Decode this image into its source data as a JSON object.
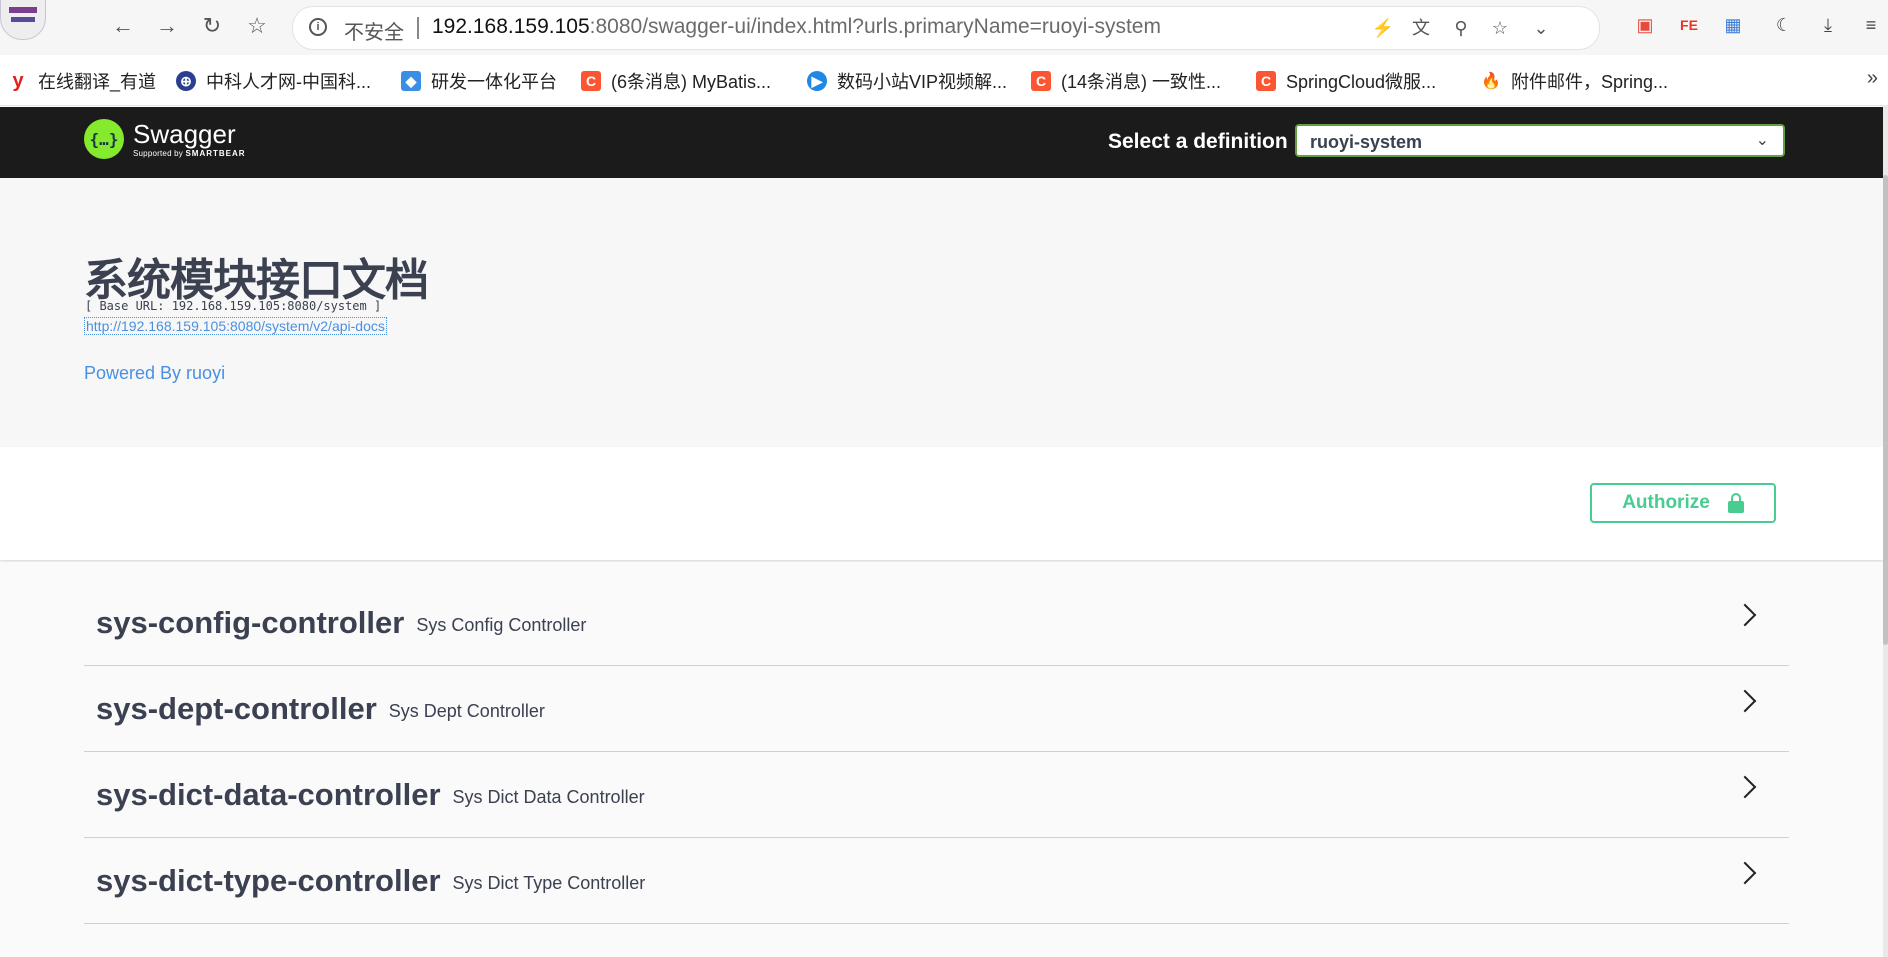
{
  "browser": {
    "url_security": "不安全",
    "url_host": "192.168.159.105",
    "url_rest": ":8080/swagger-ui/index.html?urls.primaryName=ruoyi-system"
  },
  "bookmarks": [
    {
      "label": "在线翻译_有道",
      "icon": "youdao-icon",
      "icon_text": "y",
      "color": "#e0201b"
    },
    {
      "label": "中科人才网-中国科...",
      "icon": "cas-icon",
      "icon_text": "⊕",
      "color": "#2a3f8f"
    },
    {
      "label": "研发一体化平台",
      "icon": "platform-icon",
      "icon_text": "◆",
      "color": "#3a8ee6"
    },
    {
      "label": "(6条消息) MyBatis...",
      "icon": "csdn-icon",
      "icon_text": "C",
      "color": "#fc5531"
    },
    {
      "label": "数码小站VIP视频解...",
      "icon": "video-icon",
      "icon_text": "▶",
      "color": "#1e88e5"
    },
    {
      "label": "(14条消息) 一致性...",
      "icon": "csdn-icon",
      "icon_text": "C",
      "color": "#fc5531"
    },
    {
      "label": "SpringCloud微服...",
      "icon": "csdn-icon",
      "icon_text": "C",
      "color": "#fc5531"
    },
    {
      "label": "附件邮件，Spring...",
      "icon": "flame-icon",
      "icon_text": "🔥",
      "color": "#ffffff"
    }
  ],
  "swagger": {
    "logo_name": "Swagger",
    "logo_sub_prefix": "Supported by",
    "logo_sub_brand": "SMARTBEAR",
    "definition_label": "Select a definition",
    "definition_value": "ruoyi-system"
  },
  "info": {
    "title": "系统模块接口文档",
    "base_url": "[ Base URL: 192.168.159.105:8080/system ]",
    "api_docs_link": "http://192.168.159.105:8080/system/v2/api-docs",
    "powered_by": "Powered By ruoyi"
  },
  "authorize_label": "Authorize",
  "controllers": [
    {
      "name": "sys-config-controller",
      "desc": "Sys Config Controller"
    },
    {
      "name": "sys-dept-controller",
      "desc": "Sys Dept Controller"
    },
    {
      "name": "sys-dict-data-controller",
      "desc": "Sys Dict Data Controller"
    },
    {
      "name": "sys-dict-type-controller",
      "desc": "Sys Dict Type Controller"
    }
  ],
  "colors": {
    "topbar": "#1b1b1b",
    "swagger_green": "#85ea2d",
    "authorize_green": "#49cc90",
    "link_blue": "#4990e2"
  }
}
